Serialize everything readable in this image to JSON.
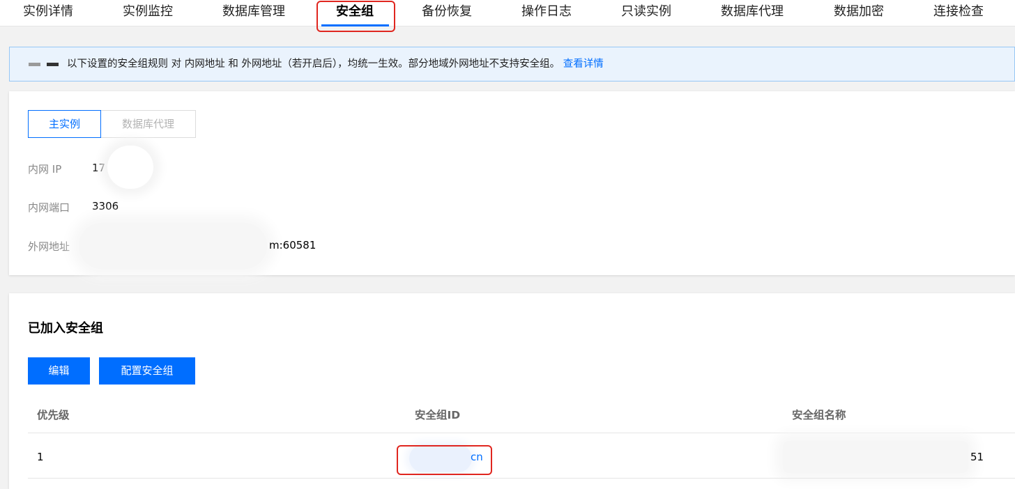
{
  "tabs": [
    {
      "label": "实例详情"
    },
    {
      "label": "实例监控"
    },
    {
      "label": "数据库管理"
    },
    {
      "label": "安全组"
    },
    {
      "label": "备份恢复"
    },
    {
      "label": "操作日志"
    },
    {
      "label": "只读实例"
    },
    {
      "label": "数据库代理"
    },
    {
      "label": "数据加密"
    },
    {
      "label": "连接检查"
    }
  ],
  "notice": {
    "text": "以下设置的安全组规则 对 内网地址 和 外网地址（若开启后），均统一生效。部分地域外网地址不支持安全组。",
    "link": "查看详情"
  },
  "instance": {
    "segments": [
      "主实例",
      "数据库代理"
    ],
    "fields": [
      {
        "label": "内网 IP",
        "value": "17"
      },
      {
        "label": "内网端口",
        "value": "3306"
      },
      {
        "label": "外网地址",
        "value": "m:60581"
      }
    ]
  },
  "security_groups": {
    "title": "已加入安全组",
    "buttons": {
      "edit": "编辑",
      "configure": "配置安全组"
    },
    "columns": [
      "优先级",
      "安全组ID",
      "安全组名称"
    ],
    "rows": [
      {
        "priority": "1",
        "id": "cn",
        "name": "51"
      }
    ]
  },
  "colors": {
    "accent": "#006eff",
    "highlight": "#e0261f"
  }
}
